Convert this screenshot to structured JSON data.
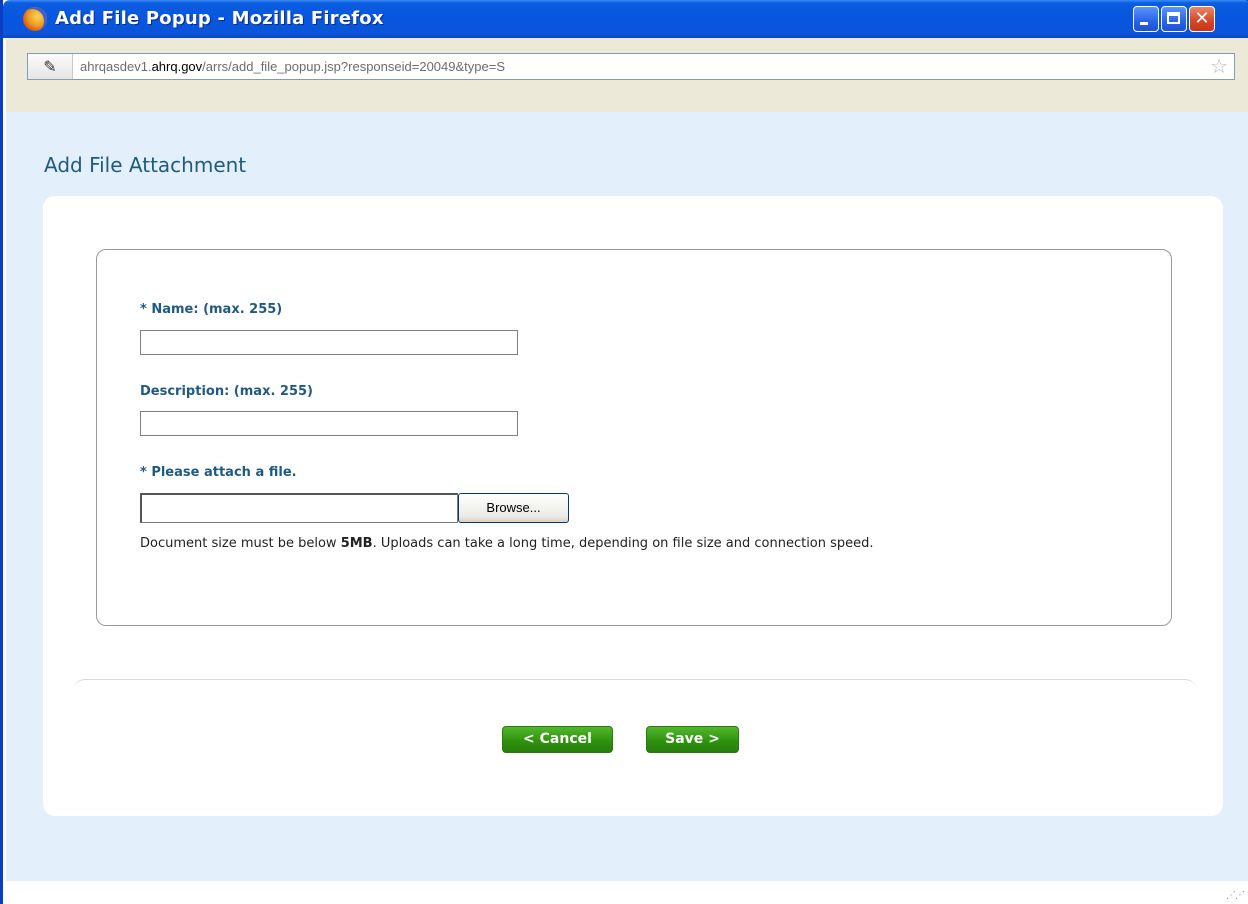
{
  "window": {
    "title": "Add File Popup - Mozilla Firefox",
    "icon": "firefox-icon",
    "controls": {
      "minimize": "minimize-icon",
      "maximize": "maximize-icon",
      "close": "close-icon"
    }
  },
  "addressbar": {
    "site_icon": "hhs-site-icon",
    "url_prefix": "ahrqasdev1.",
    "url_domain": "ahrq.gov",
    "url_path": "/arrs/add_file_popup.jsp?responseid=20049&type=S",
    "bookmark_icon": "star-icon"
  },
  "page": {
    "title": "Add File Attachment",
    "form": {
      "name_label": "* Name: (max. 255)",
      "name_value": "",
      "description_label": "Description: (max. 255)",
      "description_value": "",
      "file_label": "* Please attach a file.",
      "file_value": "",
      "browse_label": "Browse...",
      "hint_before": "Document size must be below ",
      "hint_bold": "5MB",
      "hint_after": ". Uploads can take a long time, depending on file size and connection speed."
    },
    "buttons": {
      "cancel_label": "< Cancel",
      "save_label": "Save >"
    }
  },
  "colors": {
    "accent": "#1f5a85",
    "button_green": "#2f9310",
    "page_bg": "#e3f0fb",
    "titlebar_blue": "#0856e0"
  }
}
